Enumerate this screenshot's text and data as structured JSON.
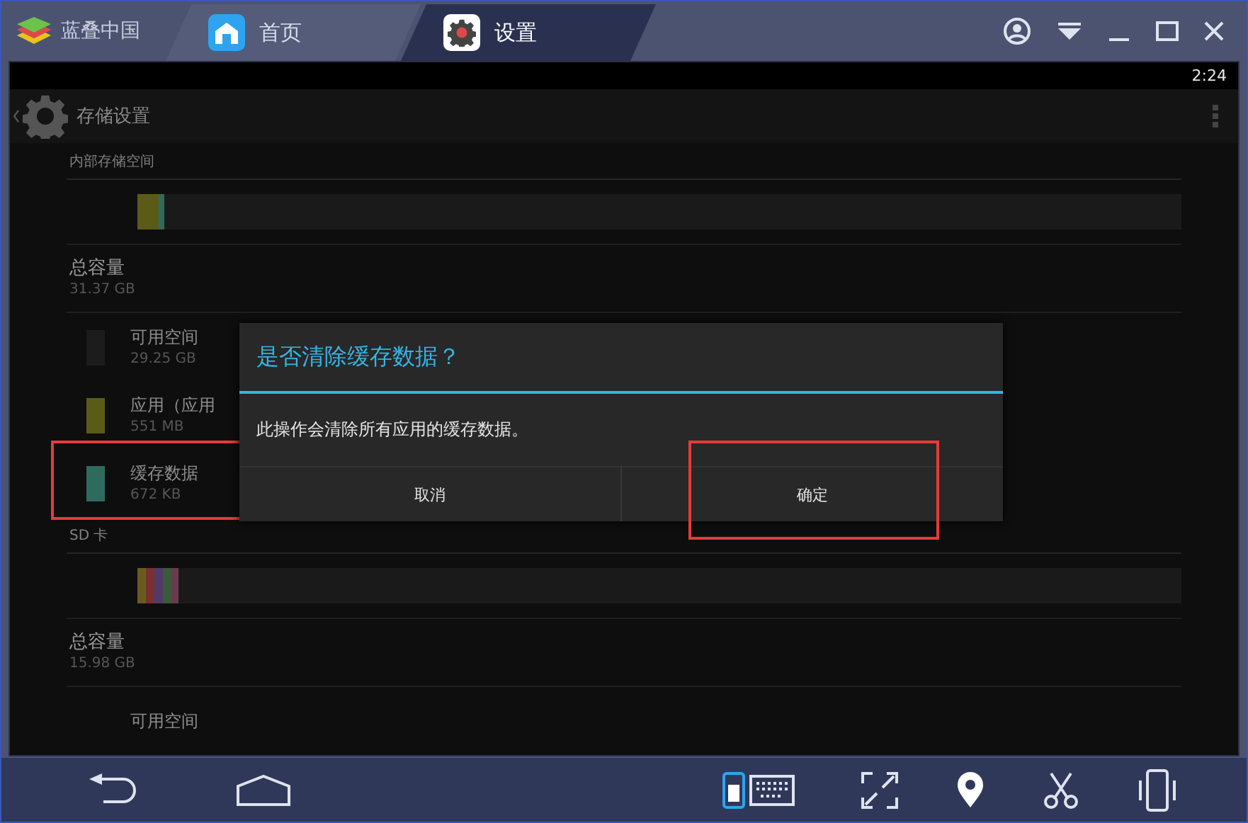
{
  "app": {
    "name": "蓝叠中国"
  },
  "tabs": [
    {
      "label": "首页",
      "selected": false
    },
    {
      "label": "设置",
      "selected": true
    }
  ],
  "status_bar": {
    "time": "2:24"
  },
  "action_bar": {
    "title": "存储设置"
  },
  "sections": [
    {
      "header": "内部存储空间",
      "bar": [
        {
          "color": "#5b5b18",
          "level": 0.021
        },
        {
          "color": "#2e6b5e",
          "level": 0.005
        }
      ],
      "total": {
        "label": "总容量",
        "value": "31.37 GB"
      },
      "items": [
        {
          "label": "可用空间",
          "value": "29.25 GB",
          "color": "#1c1c1c",
          "highlighted": false
        },
        {
          "label": "应用（应用",
          "value": "551 MB",
          "color": "#5b5b18",
          "highlighted": false
        },
        {
          "label": "缓存数据",
          "value": "672 KB",
          "color": "#2e6b5e",
          "highlighted": true
        }
      ]
    },
    {
      "header": "SD 卡",
      "bar": [
        {
          "color": "#6a5a20",
          "level": 0.008
        },
        {
          "color": "#7a3030",
          "level": 0.008
        },
        {
          "color": "#503a6a",
          "level": 0.008
        },
        {
          "color": "#3a5a3a",
          "level": 0.008
        },
        {
          "color": "#6a3a50",
          "level": 0.007
        }
      ],
      "total": {
        "label": "总容量",
        "value": "15.98 GB"
      },
      "items": [
        {
          "label": "可用空间",
          "highlighted": false
        }
      ]
    }
  ],
  "dialog": {
    "title": "是否清除缓存数据？",
    "message": "此操作会清除所有应用的缓存数据。",
    "buttons": [
      {
        "label": "取消",
        "highlighted": false
      },
      {
        "label": "确定",
        "highlighted": true
      }
    ]
  }
}
